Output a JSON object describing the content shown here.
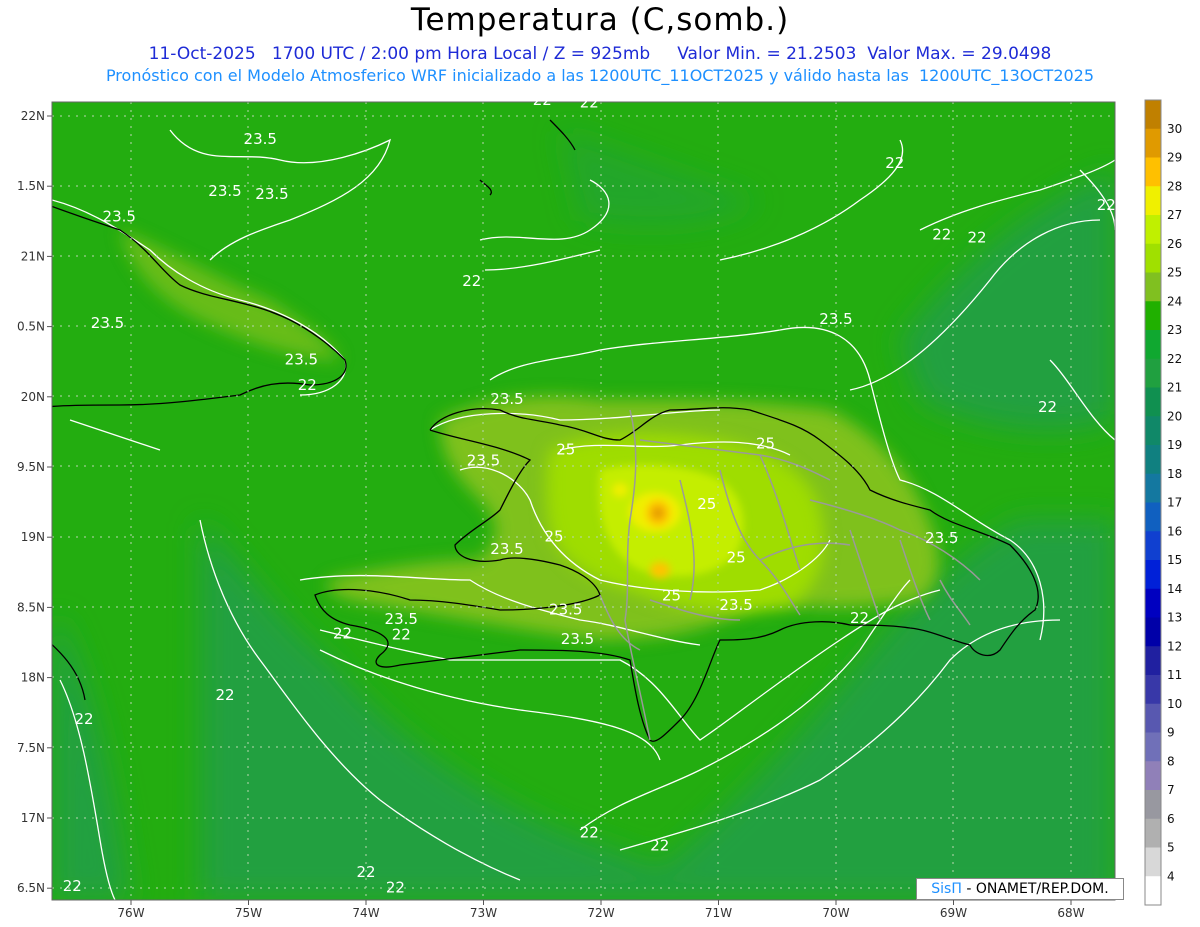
{
  "header": {
    "title": "Temperatura (C,somb.)",
    "line1": "11-Oct-2025   1700 UTC / 2:00 pm Hora Local / Z = 925mb     Valor Min. = 21.2503  Valor Max. = 29.0498",
    "line2": "Pronóstico con el Modelo Atmosferico WRF inicializado a las 1200UTC_11OCT2025 y válido hasta las  1200UTC_13OCT2025"
  },
  "map": {
    "lon_ticks": [
      "76W",
      "75W",
      "74W",
      "73W",
      "72W",
      "71W",
      "70W",
      "69W",
      "68W"
    ],
    "lat_ticks": [
      "22N",
      "1.5N",
      "21N",
      "0.5N",
      "20N",
      "9.5N",
      "19N",
      "8.5N",
      "18N",
      "7.5N",
      "17N",
      "6.5N"
    ],
    "contour_labels": [
      {
        "text": "23.5",
        "lon": -74.9,
        "lat": 21.8
      },
      {
        "text": "23.5",
        "lon": -75.2,
        "lat": 21.43
      },
      {
        "text": "23.5",
        "lon": -74.8,
        "lat": 21.41
      },
      {
        "text": "23.5",
        "lon": -76.1,
        "lat": 21.25
      },
      {
        "text": "23.5",
        "lon": -76.2,
        "lat": 20.49
      },
      {
        "text": "23.5",
        "lon": -74.55,
        "lat": 20.23
      },
      {
        "text": "22",
        "lon": -74.5,
        "lat": 20.05
      },
      {
        "text": "22",
        "lon": -72.5,
        "lat": 22.08
      },
      {
        "text": "22",
        "lon": -72.1,
        "lat": 22.06
      },
      {
        "text": "22",
        "lon": -73.1,
        "lat": 20.79
      },
      {
        "text": "23.5",
        "lon": -70.0,
        "lat": 20.52
      },
      {
        "text": "22",
        "lon": -69.5,
        "lat": 21.63
      },
      {
        "text": "22",
        "lon": -69.1,
        "lat": 21.12
      },
      {
        "text": "22",
        "lon": -68.8,
        "lat": 21.1
      },
      {
        "text": "22",
        "lon": -67.7,
        "lat": 21.33
      },
      {
        "text": "22",
        "lon": -68.2,
        "lat": 19.89
      },
      {
        "text": "23.5",
        "lon": -72.8,
        "lat": 19.95
      },
      {
        "text": "23.5",
        "lon": -73.0,
        "lat": 19.51
      },
      {
        "text": "25",
        "lon": -72.3,
        "lat": 19.59
      },
      {
        "text": "25",
        "lon": -70.6,
        "lat": 19.63
      },
      {
        "text": "25",
        "lon": -71.1,
        "lat": 19.2
      },
      {
        "text": "25",
        "lon": -72.4,
        "lat": 18.97
      },
      {
        "text": "23.5",
        "lon": -72.8,
        "lat": 18.88
      },
      {
        "text": "25",
        "lon": -70.85,
        "lat": 18.82
      },
      {
        "text": "23.5",
        "lon": -69.1,
        "lat": 18.96
      },
      {
        "text": "25",
        "lon": -71.4,
        "lat": 18.55
      },
      {
        "text": "23.5",
        "lon": -70.85,
        "lat": 18.48
      },
      {
        "text": "23.5",
        "lon": -72.3,
        "lat": 18.45
      },
      {
        "text": "23.5",
        "lon": -73.7,
        "lat": 18.38
      },
      {
        "text": "23.5",
        "lon": -72.2,
        "lat": 18.24
      },
      {
        "text": "22",
        "lon": -74.2,
        "lat": 18.28
      },
      {
        "text": "22",
        "lon": -73.7,
        "lat": 18.27
      },
      {
        "text": "22",
        "lon": -69.8,
        "lat": 18.39
      },
      {
        "text": "22",
        "lon": -75.2,
        "lat": 17.84
      },
      {
        "text": "22",
        "lon": -76.4,
        "lat": 17.67
      },
      {
        "text": "22",
        "lon": -72.1,
        "lat": 16.86
      },
      {
        "text": "22",
        "lon": -71.5,
        "lat": 16.77
      },
      {
        "text": "22",
        "lon": -74.0,
        "lat": 16.58
      },
      {
        "text": "22",
        "lon": -73.75,
        "lat": 16.47
      },
      {
        "text": "22",
        "lon": -76.5,
        "lat": 16.48
      }
    ]
  },
  "colorbar": {
    "labels": [
      "30",
      "29",
      "28",
      "27",
      "26",
      "25",
      "24",
      "23",
      "22",
      "21",
      "20",
      "19",
      "18",
      "17",
      "16",
      "15",
      "14",
      "13",
      "12",
      "11",
      "10",
      "9",
      "8",
      "7",
      "6",
      "5",
      "4"
    ],
    "colors": [
      "#c08000",
      "#e09a00",
      "#ffc000",
      "#f0f000",
      "#c0f000",
      "#a0e000",
      "#80c020",
      "#20b000",
      "#10a830",
      "#20a040",
      "#109050",
      "#108868",
      "#108080",
      "#1478a0",
      "#1060c0",
      "#1040d0",
      "#0020d8",
      "#0000c0",
      "#0000a8",
      "#2020a0",
      "#3838a8",
      "#5858b0",
      "#7070b8",
      "#9080b8",
      "#9898a0",
      "#b0b0b0",
      "#d8d8d8",
      "#ffffff"
    ]
  },
  "footer": {
    "sis": "SisΠ",
    "org": " - ONAMET/REP.DOM."
  }
}
